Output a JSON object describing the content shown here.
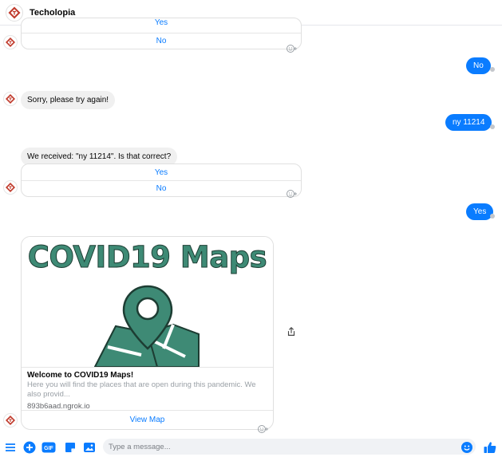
{
  "header": {
    "title": "Techolopia"
  },
  "messages": {
    "first_card": {
      "yes": "Yes",
      "no": "No"
    },
    "out_no": "No",
    "in_sorry": "Sorry, please try again!",
    "out_zip": "ny  11214",
    "in_received": "We received: \"ny  11214\". Is that correct?",
    "second_card": {
      "yes": "Yes",
      "no": "No"
    },
    "out_yes": "Yes"
  },
  "map_card": {
    "hero_title": "COVID19 Maps",
    "title": "Welcome to COVID19 Maps!",
    "description": "Here you will find the places that are open during this pandemic. We also provid...",
    "url": "893b6aad.ngrok.io",
    "button": "View Map"
  },
  "composer": {
    "placeholder": "Type a message...",
    "gif_label": "GIF"
  },
  "colors": {
    "accent": "#0a7cff",
    "map_green": "#3e8a75",
    "brand_red": "#c0392b"
  },
  "icons": [
    "menu-icon",
    "plus-icon",
    "gif-icon",
    "sticker-icon",
    "image-icon",
    "emoji-icon",
    "like-icon",
    "share-icon",
    "reaction-icon"
  ]
}
